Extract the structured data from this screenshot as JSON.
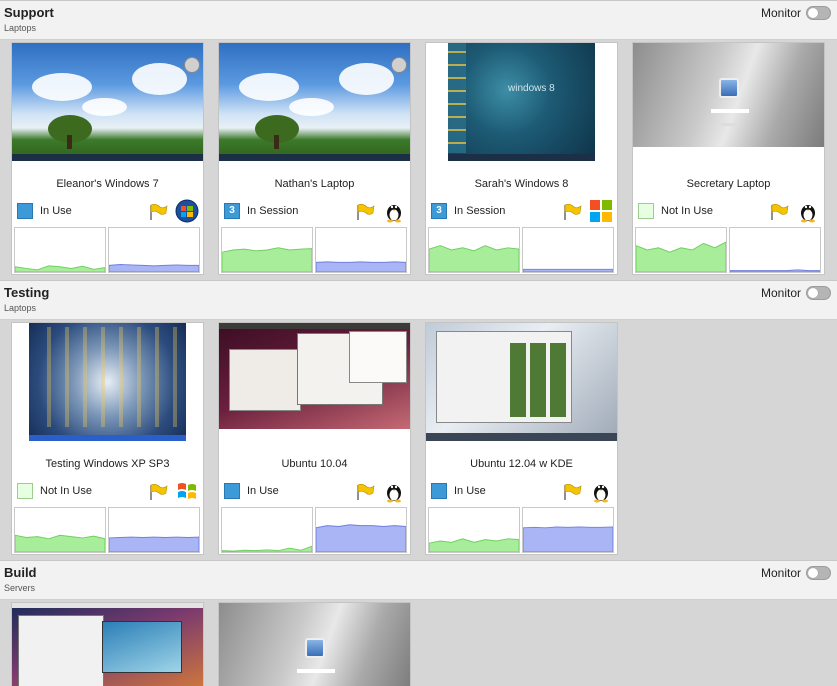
{
  "groups": [
    {
      "title": "Support",
      "subtitle": "Laptops",
      "monitor_label": "Monitor"
    },
    {
      "title": "Testing",
      "subtitle": "Laptops",
      "monitor_label": "Monitor"
    },
    {
      "title": "Build",
      "subtitle": "Servers",
      "monitor_label": "Monitor"
    }
  ],
  "cards": [
    {
      "name": "Eleanor's Windows 7",
      "status": "In Use",
      "status_icon": "blue-square",
      "os": "windows-7-icon",
      "cpu": [
        0.12,
        0.08,
        0.05,
        0.14,
        0.12,
        0.08,
        0.13,
        0.06,
        0.1
      ],
      "mem": [
        0.15,
        0.17,
        0.16,
        0.15,
        0.14,
        0.15,
        0.16,
        0.15,
        0.15
      ]
    },
    {
      "name": "Nathan's Laptop",
      "status": "In Session",
      "status_icon": "3",
      "os": "linux-tux-icon",
      "cpu": [
        0.45,
        0.5,
        0.52,
        0.48,
        0.5,
        0.55,
        0.5,
        0.52,
        0.53
      ],
      "mem": [
        0.22,
        0.23,
        0.22,
        0.22,
        0.23,
        0.22,
        0.22,
        0.23,
        0.22
      ]
    },
    {
      "name": "Sarah's Windows 8",
      "status": "In Session",
      "status_icon": "3",
      "os": "windows-8-icon",
      "cpu": [
        0.52,
        0.6,
        0.5,
        0.55,
        0.48,
        0.6,
        0.5,
        0.55,
        0.52
      ],
      "mem": [
        0.06,
        0.06,
        0.06,
        0.06,
        0.06,
        0.06,
        0.06,
        0.06,
        0.06
      ]
    },
    {
      "name": "Secretary Laptop",
      "status": "Not In Use",
      "status_icon": "empty-square",
      "os": "linux-tux-icon",
      "cpu": [
        0.6,
        0.5,
        0.55,
        0.45,
        0.55,
        0.5,
        0.65,
        0.55,
        0.68
      ],
      "mem": [
        0.03,
        0.03,
        0.03,
        0.03,
        0.03,
        0.03,
        0.05,
        0.03,
        0.03
      ]
    },
    {
      "name": "Testing Windows XP SP3",
      "status": "Not In Use",
      "status_icon": "empty-square",
      "os": "windows-xp-icon",
      "cpu": [
        0.38,
        0.33,
        0.35,
        0.3,
        0.38,
        0.35,
        0.32,
        0.36,
        0.3
      ],
      "mem": [
        0.32,
        0.33,
        0.34,
        0.33,
        0.34,
        0.33,
        0.34,
        0.33,
        0.34
      ]
    },
    {
      "name": "Ubuntu 10.04",
      "status": "In Use",
      "status_icon": "blue-square",
      "os": "linux-tux-icon",
      "cpu": [
        0.03,
        0.02,
        0.04,
        0.03,
        0.05,
        0.03,
        0.09,
        0.04,
        0.13
      ],
      "mem": [
        0.55,
        0.6,
        0.58,
        0.62,
        0.6,
        0.6,
        0.58,
        0.6,
        0.58
      ]
    },
    {
      "name": "Ubuntu 12.04 w KDE",
      "status": "In Use",
      "status_icon": "blue-square",
      "os": "linux-tux-icon",
      "cpu": [
        0.2,
        0.25,
        0.22,
        0.3,
        0.22,
        0.28,
        0.25,
        0.3,
        0.28
      ],
      "mem": [
        0.55,
        0.56,
        0.55,
        0.57,
        0.56,
        0.57,
        0.56,
        0.56,
        0.57
      ]
    }
  ],
  "colors": {
    "cpu_fill": "#a8ee9a",
    "cpu_line": "#6fcf5f",
    "mem_fill": "#a9b5f5",
    "mem_line": "#6f7fe0",
    "accent_blue": "#3d9ad8"
  }
}
